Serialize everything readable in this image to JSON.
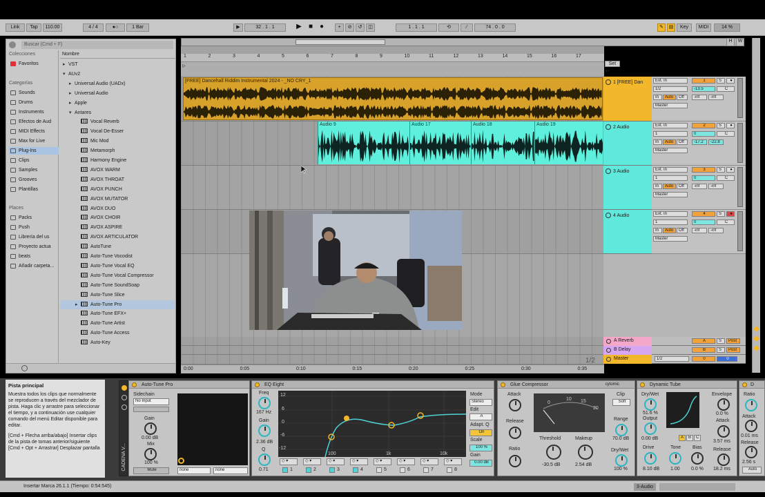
{
  "controlbar": {
    "link": "Link",
    "tap": "Tap",
    "tempo": "110.00",
    "signature": "4 / 4",
    "record_mode": "●○",
    "quantize": "1 Bar",
    "position": "32 . 1 . 1",
    "loop_start": "1 . 1 . 1",
    "loop_length": "74 . 0 . 0",
    "key": "Key",
    "midi": "MIDI",
    "cpu": "14 %"
  },
  "browser": {
    "search_placeholder": "Buscar (Cmd + F)",
    "collections_header": "Colecciones",
    "favorites": "Favoritos",
    "categories_header": "Categorías",
    "categories": [
      "Sounds",
      "Drums",
      "Instruments",
      "Efectos de Aud",
      "MIDI Effects",
      "Max for Live",
      "Plug-Ins",
      "Clips",
      "Samples",
      "Grooves",
      "Plantillas"
    ],
    "places_header": "Places",
    "places": [
      "Packs",
      "Push",
      "Librería del us",
      "Proyecto actua",
      "beats",
      "Añadir carpeta..."
    ],
    "name_header": "Nombre",
    "tree": [
      {
        "label": "VST",
        "level": 0,
        "type": "folder"
      },
      {
        "label": "AUv2",
        "level": 0,
        "type": "folder-open"
      },
      {
        "label": "Universal Audio (UADx)",
        "level": 1,
        "type": "folder"
      },
      {
        "label": "Universal Audio",
        "level": 1,
        "type": "folder"
      },
      {
        "label": "Apple",
        "level": 1,
        "type": "folder"
      },
      {
        "label": "Antares",
        "level": 1,
        "type": "folder-open"
      },
      {
        "label": "Vocal Reverb",
        "level": 2,
        "type": "plugin"
      },
      {
        "label": "Vocal De-Esser",
        "level": 2,
        "type": "plugin"
      },
      {
        "label": "Mic Mod",
        "level": 2,
        "type": "plugin"
      },
      {
        "label": "Metamorph",
        "level": 2,
        "type": "plugin"
      },
      {
        "label": "Harmony Engine",
        "level": 2,
        "type": "plugin"
      },
      {
        "label": "AVOX WARM",
        "level": 2,
        "type": "plugin"
      },
      {
        "label": "AVOX THROAT",
        "level": 2,
        "type": "plugin"
      },
      {
        "label": "AVOX PUNCH",
        "level": 2,
        "type": "plugin"
      },
      {
        "label": "AVOX MUTATOR",
        "level": 2,
        "type": "plugin"
      },
      {
        "label": "AVOX DUO",
        "level": 2,
        "type": "plugin"
      },
      {
        "label": "AVOX CHOIR",
        "level": 2,
        "type": "plugin"
      },
      {
        "label": "AVOX ASPIRE",
        "level": 2,
        "type": "plugin"
      },
      {
        "label": "AVOX ARTICULATOR",
        "level": 2,
        "type": "plugin"
      },
      {
        "label": "AutoTune",
        "level": 2,
        "type": "plugin"
      },
      {
        "label": "Auto-Tune Vocodist",
        "level": 2,
        "type": "plugin"
      },
      {
        "label": "Auto-Tune Vocal EQ",
        "level": 2,
        "type": "plugin"
      },
      {
        "label": "Auto-Tune Vocal Compressor",
        "level": 2,
        "type": "plugin"
      },
      {
        "label": "Auto-Tune SoundSoap",
        "level": 2,
        "type": "plugin"
      },
      {
        "label": "Auto-Tune Slice",
        "level": 2,
        "type": "plugin"
      },
      {
        "label": "Auto-Tune Pro",
        "level": 2,
        "type": "plugin",
        "selected": true
      },
      {
        "label": "Auto-Tune EFX+",
        "level": 2,
        "type": "plugin"
      },
      {
        "label": "Auto-Tune Artist",
        "level": 2,
        "type": "plugin"
      },
      {
        "label": "Auto-Tune Access",
        "level": 2,
        "type": "plugin"
      },
      {
        "label": "Auto-Key",
        "level": 2,
        "type": "plugin"
      }
    ]
  },
  "ruler_bars": [
    "1",
    "2",
    "3",
    "4",
    "5",
    "6",
    "7",
    "8",
    "9",
    "10",
    "11",
    "12",
    "13",
    "14",
    "15",
    "16",
    "17"
  ],
  "set_label": "Set",
  "time_labels": [
    "0:00",
    "0:05",
    "0:10",
    "0:15",
    "0:20",
    "0:25",
    "0:30",
    "0:35"
  ],
  "zoom_label": "1/2",
  "tracks": [
    {
      "name": "1 [FREE] Dan",
      "num": "1",
      "input": "Ext. In",
      "channel": "1/2",
      "out": "Master",
      "vol": "-13.5",
      "pan": "C",
      "sends": [
        "-inf",
        "-inf"
      ],
      "color": "#f2b72a"
    },
    {
      "name": "2 Audio",
      "num": "2",
      "input": "Ext. In",
      "channel": "1",
      "out": "Master",
      "vol": "0",
      "pan": "C",
      "sends": [
        "-17.2",
        "-22.8"
      ],
      "color": "#5fe8dc"
    },
    {
      "name": "3 Audio",
      "num": "3",
      "input": "Ext. In",
      "channel": "1",
      "out": "Master",
      "vol": "0",
      "pan": "C",
      "sends": [
        "-inf",
        "-inf"
      ],
      "color": "#5fe8dc"
    },
    {
      "name": "4 Audio",
      "num": "4",
      "input": "Ext. In",
      "channel": "1",
      "out": "Master",
      "vol": "0",
      "pan": "C",
      "sends": [
        "-inf",
        "-inf"
      ],
      "color": "#5fe8dc"
    }
  ],
  "track_buttons": {
    "in": "In",
    "auto": "Auto",
    "off": "Off",
    "solo": "S"
  },
  "clip1_label": "[FREE] Dancehall Riddim Instrumental 2024 - _NO CRY_1",
  "aqua_clips": [
    "Audio 9",
    "Audio 17",
    "Audio 18",
    "Audio 19"
  ],
  "returns": [
    {
      "name": "A Reverb",
      "num": "A",
      "post": "Post",
      "color": "#f4a7c8"
    },
    {
      "name": "B Delay",
      "num": "B",
      "post": "Post",
      "color": "#d6a7f0"
    },
    {
      "name": "Master",
      "num": "0",
      "post": "1/2",
      "color": "#f2b72a"
    }
  ],
  "info": {
    "title": "Pista principal",
    "body": "Muestra todos los clips que normalmente se reproducen a través del mezclador de pista. Haga clic y arrastre para seleccionar el tiempo, y a continuación use cualquier comando del menú Editar disponible para editar.",
    "shortcuts": "[Cmd + Flecha arriba/abajo] Insertar clips de la pista de tomas anterior/siguiente\n[Cmd + Opt + Arrastrar] Desplazar pantalla"
  },
  "devices": {
    "chain_label": "CADENA V...",
    "autotune": {
      "title": "Auto-Tune Pro",
      "sidechain": "Sidechain",
      "sidechain_val": "No Input",
      "gain": "Gain",
      "gain_val": "0.00 dB",
      "mix": "Mix",
      "mix_val": "100 %",
      "mute": "Mute",
      "none1": "none",
      "none2": "none"
    },
    "eq": {
      "title": "EQ Eight",
      "freq": "Freq",
      "freq_val": "167 Hz",
      "gain": "Gain",
      "gain_val": "2.36 dB",
      "q": "Q",
      "q_val": "0.71",
      "mode": "Mode",
      "mode_val": "Stereo",
      "edit": "Edit",
      "edit_val": "A",
      "adapt": "Adapt. Q",
      "adapt_val": "On",
      "scale": "Scale",
      "scale_val": "100 %",
      "out_gain": "Gain",
      "out_gain_val": "0.00 dB",
      "db_labels": [
        "12",
        "6",
        "0",
        "-6",
        "-12"
      ],
      "freq_labels": [
        "100",
        "1k",
        "10k"
      ],
      "bands": [
        "1",
        "2",
        "3",
        "4",
        "5",
        "6",
        "7",
        "8"
      ]
    },
    "glue": {
      "title": "Glue Compressor",
      "brand": "cytomic",
      "attack": "Attack",
      "release": "Release",
      "ratio": "Ratio",
      "threshold": "Threshold",
      "threshold_val": "-30.5 dB",
      "makeup": "Makeup",
      "makeup_val": "2.54 dB",
      "clip": "Clip",
      "clip_val": "Soft",
      "range": "Range",
      "range_val": "70.0 dB",
      "drywet": "Dry/Wet",
      "drywet_val": "100 %",
      "meter": [
        "0",
        "10",
        "15",
        "20"
      ]
    },
    "tube": {
      "title": "Dynamic Tube",
      "drywet": "Dry/Wet",
      "drywet_val": "51.6 %",
      "output": "Output",
      "output_val": "0.00 dB",
      "drive": "Drive",
      "drive_val": "8.10 dB",
      "tone": "Tone",
      "tone_val": "1.00",
      "bias": "Bias",
      "bias_val": "0.0 %",
      "envelope": "Envelope",
      "envelope_val": "0.0 %",
      "attack": "Attack",
      "attack_val": "3.57 ms",
      "release": "Release",
      "release_val": "18.2 ms",
      "abc": [
        "A",
        "B",
        "C"
      ]
    },
    "last": {
      "title": "D",
      "ratio": "Ratio",
      "attack": "Attack",
      "attack_val": "0.01 ms",
      "release": "Release",
      "release_val": "2.56 s",
      "auto": "Auto"
    }
  },
  "status": {
    "text": "Insertar Marca 26.1.1 (Tiempo: 0:54:545)",
    "track": "3-Audio"
  },
  "colors": {
    "accent": "#f2b72a",
    "aqua": "#5ff0dd",
    "clip_gold": "#d8a22a",
    "selection": "#a9c3e3"
  }
}
